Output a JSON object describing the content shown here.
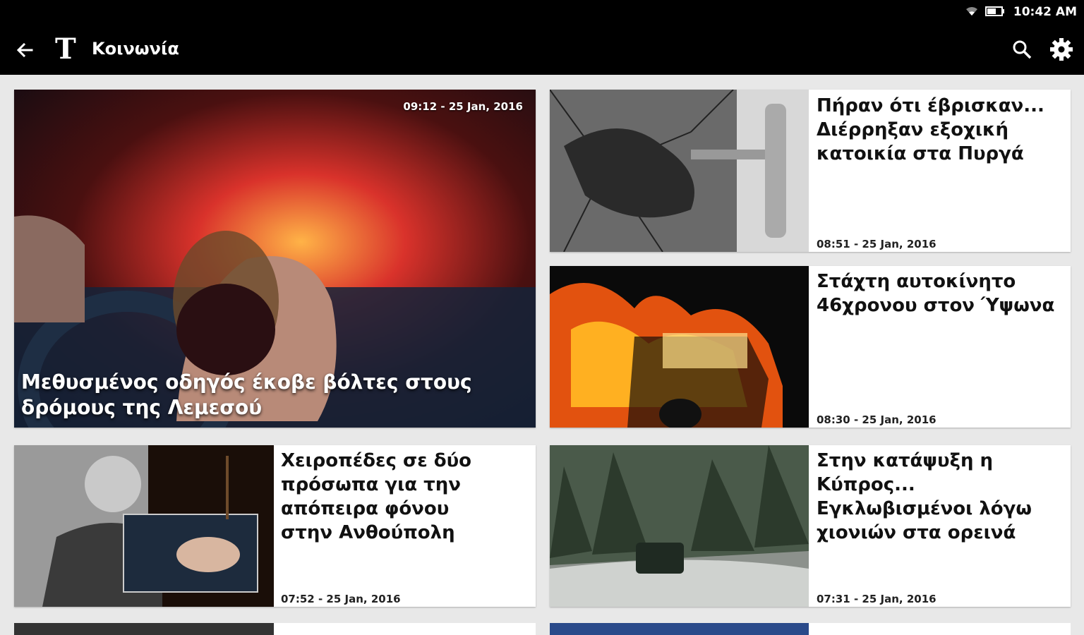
{
  "status": {
    "time": "10:42 AM"
  },
  "appbar": {
    "title": "Κοινωνία",
    "logo_letter": "T"
  },
  "featured": {
    "headline": "Μεθυσμένος οδηγός έκοβε βόλτες στους δρόμους της Λεμεσού",
    "timestamp": "09:12 - 25 Jan, 2016"
  },
  "articles": [
    {
      "headline": "Πήραν ότι έβρισκαν... Διέρρηξαν εξοχική κατοικία στα Πυργά",
      "timestamp": "08:51 - 25 Jan, 2016"
    },
    {
      "headline": "Στάχτη αυτοκίνητο 46χρονου στον Ύψωνα",
      "timestamp": "08:30 - 25 Jan, 2016"
    },
    {
      "headline": "Χειροπέδες σε δύο πρόσωπα για την απόπειρα φόνου στην Ανθούπολη",
      "timestamp": "07:52 - 25 Jan, 2016"
    },
    {
      "headline": "Στην κατάψυξη η Κύπρος... Εγκλωβισμένοι λόγω χιονιών στα ορεινά",
      "timestamp": "07:31 - 25 Jan, 2016"
    }
  ],
  "icons": {
    "back": "arrow-back-icon",
    "search": "search-icon",
    "settings": "gear-icon",
    "wifi": "wifi-icon",
    "battery": "battery-icon"
  }
}
